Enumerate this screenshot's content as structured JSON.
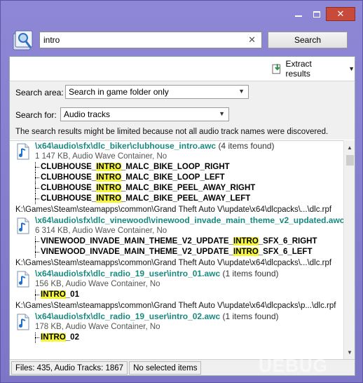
{
  "search": {
    "value": "intro",
    "clear_icon": "close-icon",
    "button_label": "Search"
  },
  "toolbar": {
    "extract_label": "Extract results"
  },
  "options": {
    "area_label": "Search area:",
    "area_value": "Search in game folder only",
    "for_label": "Search for:",
    "for_value": "Audio tracks",
    "note": "The search results might be limited because not all audio track names were discovered."
  },
  "results": [
    {
      "path": "\\x64\\audio\\sfx\\dlc_biker\\clubhouse_intro.awc",
      "count": "(4 items found)",
      "meta": "1 147 KB, Audio Wave Container, No",
      "tracks": [
        {
          "pre": "CLUBHOUSE_",
          "hl": "INTRO",
          "post": "_MALC_BIKE_LOOP_RIGHT"
        },
        {
          "pre": "CLUBHOUSE_",
          "hl": "INTRO",
          "post": "_MALC_BIKE_LOOP_LEFT"
        },
        {
          "pre": "CLUBHOUSE_",
          "hl": "INTRO",
          "post": "_MALC_BIKE_PEEL_AWAY_RIGHT"
        },
        {
          "pre": "CLUBHOUSE_",
          "hl": "INTRO",
          "post": "_MALC_BIKE_PEEL_AWAY_LEFT"
        }
      ],
      "location": "K:\\Games\\Steam\\steamapps\\common\\Grand Theft Auto V\\update\\x64\\dlcpacks\\...\\dlc.rpf"
    },
    {
      "path": "\\x64\\audio\\sfx\\dlc_vinewood\\vinewood_invade_main_theme_v2_updated.awc",
      "count": "",
      "meta": "6 314 KB, Audio Wave Container, No",
      "tracks": [
        {
          "pre": "VINEWOOD_INVADE_MAIN_THEME_V2_UPDATE_",
          "hl": "INTRO",
          "post": "_SFX_6_RIGHT"
        },
        {
          "pre": "VINEWOOD_INVADE_MAIN_THEME_V2_UPDATE_",
          "hl": "INTRO",
          "post": "_SFX_6_LEFT"
        }
      ],
      "location": "K:\\Games\\Steam\\steamapps\\common\\Grand Theft Auto V\\update\\x64\\dlcpacks\\...\\dlc.rpf"
    },
    {
      "path": "\\x64\\audio\\sfx\\dlc_radio_19_user\\intro_01.awc",
      "count": "(1 items found)",
      "meta": "156 KB, Audio Wave Container, No",
      "tracks": [
        {
          "pre": "",
          "hl": "INTRO",
          "post": "_01"
        }
      ],
      "location": "K:\\Games\\Steam\\steamapps\\common\\Grand Theft Auto V\\update\\x64\\dlcpacks\\p...\\dlc.rpf"
    },
    {
      "path": "\\x64\\audio\\sfx\\dlc_radio_19_user\\intro_02.awc",
      "count": "(1 items found)",
      "meta": "178 KB, Audio Wave Container, No",
      "tracks": [
        {
          "pre": "",
          "hl": "INTRO",
          "post": "_02"
        }
      ],
      "location": ""
    }
  ],
  "status": {
    "files": "Files: 435, Audio Tracks: 1867",
    "selection": "No selected items"
  },
  "watermark": "UEBUG"
}
